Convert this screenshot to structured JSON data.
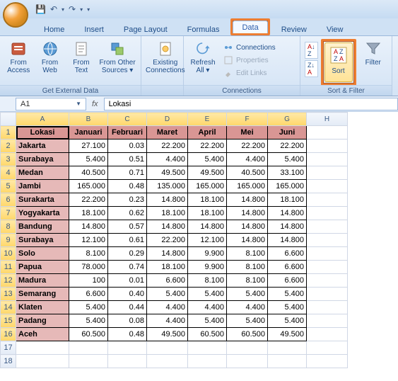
{
  "qat": {
    "save": "💾",
    "undo": "↶",
    "redo": "↷"
  },
  "tabs": [
    "Home",
    "Insert",
    "Page Layout",
    "Formulas",
    "Data",
    "Review",
    "View"
  ],
  "active_tab_index": 4,
  "ribbon": {
    "ged": {
      "label": "Get External Data",
      "access": "From\nAccess",
      "web": "From\nWeb",
      "text": "From\nText",
      "other": "From Other\nSources ▾"
    },
    "conn": {
      "ex_label": "Existing\nConnections",
      "refresh": "Refresh\nAll ▾",
      "group_label": "Connections",
      "connections": "Connections",
      "properties": "Properties",
      "edit_links": "Edit Links"
    },
    "sort": {
      "label": "Sort & Filter",
      "sort": "Sort",
      "filter": "Filter"
    }
  },
  "namebox": "A1",
  "formula": "Lokasi",
  "columns": [
    "A",
    "B",
    "C",
    "D",
    "E",
    "F",
    "G",
    "H"
  ],
  "selected_col_headers": [
    "A",
    "B",
    "C",
    "D",
    "E",
    "F",
    "G"
  ],
  "header_row": [
    "Lokasi",
    "Januari",
    "Februari",
    "Maret",
    "April",
    "Mei",
    "Juni"
  ],
  "rows": [
    [
      "Jakarta",
      "27.100",
      "0.03",
      "22.200",
      "22.200",
      "22.200",
      "22.200"
    ],
    [
      "Surabaya",
      "5.400",
      "0.51",
      "4.400",
      "5.400",
      "4.400",
      "5.400"
    ],
    [
      "Medan",
      "40.500",
      "0.71",
      "49.500",
      "49.500",
      "40.500",
      "33.100"
    ],
    [
      "Jambi",
      "165.000",
      "0.48",
      "135.000",
      "165.000",
      "165.000",
      "165.000"
    ],
    [
      "Surakarta",
      "22.200",
      "0.23",
      "14.800",
      "18.100",
      "14.800",
      "18.100"
    ],
    [
      "Yogyakarta",
      "18.100",
      "0.62",
      "18.100",
      "18.100",
      "14.800",
      "14.800"
    ],
    [
      "Bandung",
      "14.800",
      "0.57",
      "14.800",
      "14.800",
      "14.800",
      "14.800"
    ],
    [
      "Surabaya",
      "12.100",
      "0.61",
      "22.200",
      "12.100",
      "14.800",
      "14.800"
    ],
    [
      "Solo",
      "8.100",
      "0.29",
      "14.800",
      "9.900",
      "8.100",
      "6.600"
    ],
    [
      "Papua",
      "78.000",
      "0.74",
      "18.100",
      "9.900",
      "8.100",
      "6.600"
    ],
    [
      "Madura",
      "100",
      "0.01",
      "6.600",
      "8.100",
      "8.100",
      "6.600"
    ],
    [
      "Semarang",
      "6.600",
      "0.40",
      "5.400",
      "5.400",
      "5.400",
      "5.400"
    ],
    [
      "Klaten",
      "5.400",
      "0.44",
      "4.400",
      "4.400",
      "4.400",
      "5.400"
    ],
    [
      "Padang",
      "5.400",
      "0.08",
      "4.400",
      "5.400",
      "5.400",
      "5.400"
    ],
    [
      "Aceh",
      "60.500",
      "0.48",
      "49.500",
      "60.500",
      "60.500",
      "49.500"
    ]
  ]
}
